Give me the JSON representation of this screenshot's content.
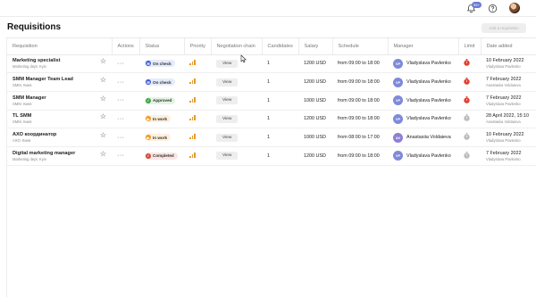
{
  "topbar": {
    "badge": "99+"
  },
  "page": {
    "title": "Requisitions",
    "add_button": "Add a requisition"
  },
  "columns": [
    "Requisition",
    "Actions",
    "Status",
    "Priority",
    "Negotiation chain",
    "Candidates",
    "Salary",
    "Schedule",
    "Manager",
    "Limit",
    "Date added"
  ],
  "rows": [
    {
      "title": "Marketing specialist",
      "sub": "Marketing dept. Kyiv",
      "actions": "···",
      "status": "On check",
      "status_color": "#3d5bd1",
      "status_bg": "#e6ebfb",
      "status_glyph": "✉",
      "view": "View",
      "candidates": "1",
      "salary": "1200 USD",
      "schedule": "from 09:00 to 18:00",
      "manager_initials": "VP",
      "manager": "Vladyslava Pavlenko",
      "manager_color": "#7e8ad9",
      "limit_color": "#e2412f",
      "date": "10 February 2022",
      "date_sub": "Vladyslava Pavlenko"
    },
    {
      "title": "SMM Manager Team Lead",
      "sub": "SMM. Киев",
      "actions": "···",
      "status": "On check",
      "status_color": "#3d5bd1",
      "status_bg": "#e6ebfb",
      "status_glyph": "✉",
      "view": "View",
      "candidates": "1",
      "salary": "1200 USD",
      "schedule": "from 09:00 to 18:00",
      "manager_initials": "VP",
      "manager": "Vladyslava Pavlenko",
      "manager_color": "#7e8ad9",
      "limit_color": "#e2412f",
      "date": "7 February 2022",
      "date_sub": "Anastasiia Voldaieva"
    },
    {
      "title": "SMM Manager",
      "sub": "SMM. Киев",
      "actions": "···",
      "status": "Approved",
      "status_color": "#3ea546",
      "status_bg": "#e4f4e3",
      "status_glyph": "✓",
      "view": "View",
      "candidates": "1",
      "salary": "1000 USD",
      "schedule": "from 09:00 to 18:00",
      "manager_initials": "VP",
      "manager": "Vladyslava Pavlenko",
      "manager_color": "#7e8ad9",
      "limit_color": "#e2412f",
      "date": "7 February 2022",
      "date_sub": "Vladyslava Pavlenko"
    },
    {
      "title": "TL SMM",
      "sub": "SMM. Киев",
      "actions": "···",
      "status": "In work",
      "status_color": "#f09a22",
      "status_bg": "#fdf0de",
      "status_glyph": "▶",
      "view": "View",
      "candidates": "1",
      "salary": "1200 USD",
      "schedule": "from 09:00 to 18:00",
      "manager_initials": "VP",
      "manager": "Vladyslava Pavlenko",
      "manager_color": "#7e8ad9",
      "limit_color": "#bdbdbd",
      "date": "28 April 2022, 15:10",
      "date_sub": "Anastasiia Voldaieva"
    },
    {
      "title": "АХО координатор",
      "sub": "АХО. Киев",
      "actions": "···",
      "status": "In work",
      "status_color": "#f09a22",
      "status_bg": "#fdf0de",
      "status_glyph": "▶",
      "view": "View",
      "candidates": "1",
      "salary": "1000 USD",
      "schedule": "from 08:00 to 17:00",
      "manager_initials": "AV",
      "manager": "Anastasiia Voldaieva",
      "manager_color": "#8e7fd6",
      "limit_color": "#bdbdbd",
      "date": "10 February 2022",
      "date_sub": "Vladyslava Pavlenko"
    },
    {
      "title": "Digital marketing manager",
      "sub": "Marketing dept. Kyiv",
      "actions": "···",
      "status": "Completed",
      "status_color": "#d04a3a",
      "status_bg": "#fbe5e2",
      "status_glyph": "✓",
      "view": "View",
      "candidates": "1",
      "salary": "1200 USD",
      "schedule": "from 09:00 to 18:00",
      "manager_initials": "VP",
      "manager": "Vladyslava Pavlenko",
      "manager_color": "#7e8ad9",
      "limit_color": "#bdbdbd",
      "date": "7 February 2022",
      "date_sub": "Vladyslava Pavlenko"
    }
  ]
}
